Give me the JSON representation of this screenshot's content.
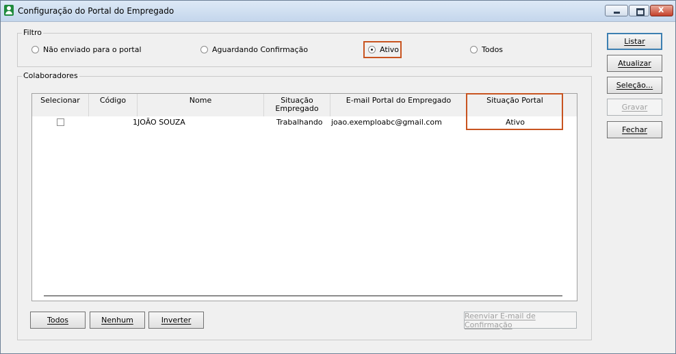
{
  "window": {
    "title": "Configuração do Portal do Empregado",
    "min_label": "",
    "max_label": "",
    "close_label": "x"
  },
  "filtro": {
    "label": "Filtro",
    "options": [
      {
        "label": "Não enviado para o portal",
        "selected": false
      },
      {
        "label": "Aguardando Confirmação",
        "selected": false
      },
      {
        "label": "Ativo",
        "selected": true
      },
      {
        "label": "Todos",
        "selected": false
      }
    ]
  },
  "colaboradores": {
    "label": "Colaboradores",
    "columns": [
      {
        "label": "Selecionar"
      },
      {
        "label": "Código"
      },
      {
        "label": "Nome"
      },
      {
        "label": "Situação\nEmpregado"
      },
      {
        "label": "E-mail Portal do Empregado"
      },
      {
        "label": "Situação Portal"
      }
    ],
    "rows": [
      {
        "selected": false,
        "codigo": "1",
        "nome": "JOÃO SOUZA",
        "situacao_empregado": "Trabalhando",
        "email": "joao.exemploabc@gmail.com",
        "situacao_portal": "Ativo"
      }
    ],
    "buttons": {
      "todos": "Todos",
      "nenhum": "Nenhum",
      "inverter": "Inverter",
      "reenviar": "Reenviar E-mail de Confirmação"
    }
  },
  "actions": {
    "listar": "Listar",
    "atualizar": "Atualizar",
    "selecao": "Seleção...",
    "gravar": "Gravar",
    "fechar": "Fechar"
  },
  "colors": {
    "highlight": "#c8531f",
    "title_bar": "#c4d6ec"
  }
}
